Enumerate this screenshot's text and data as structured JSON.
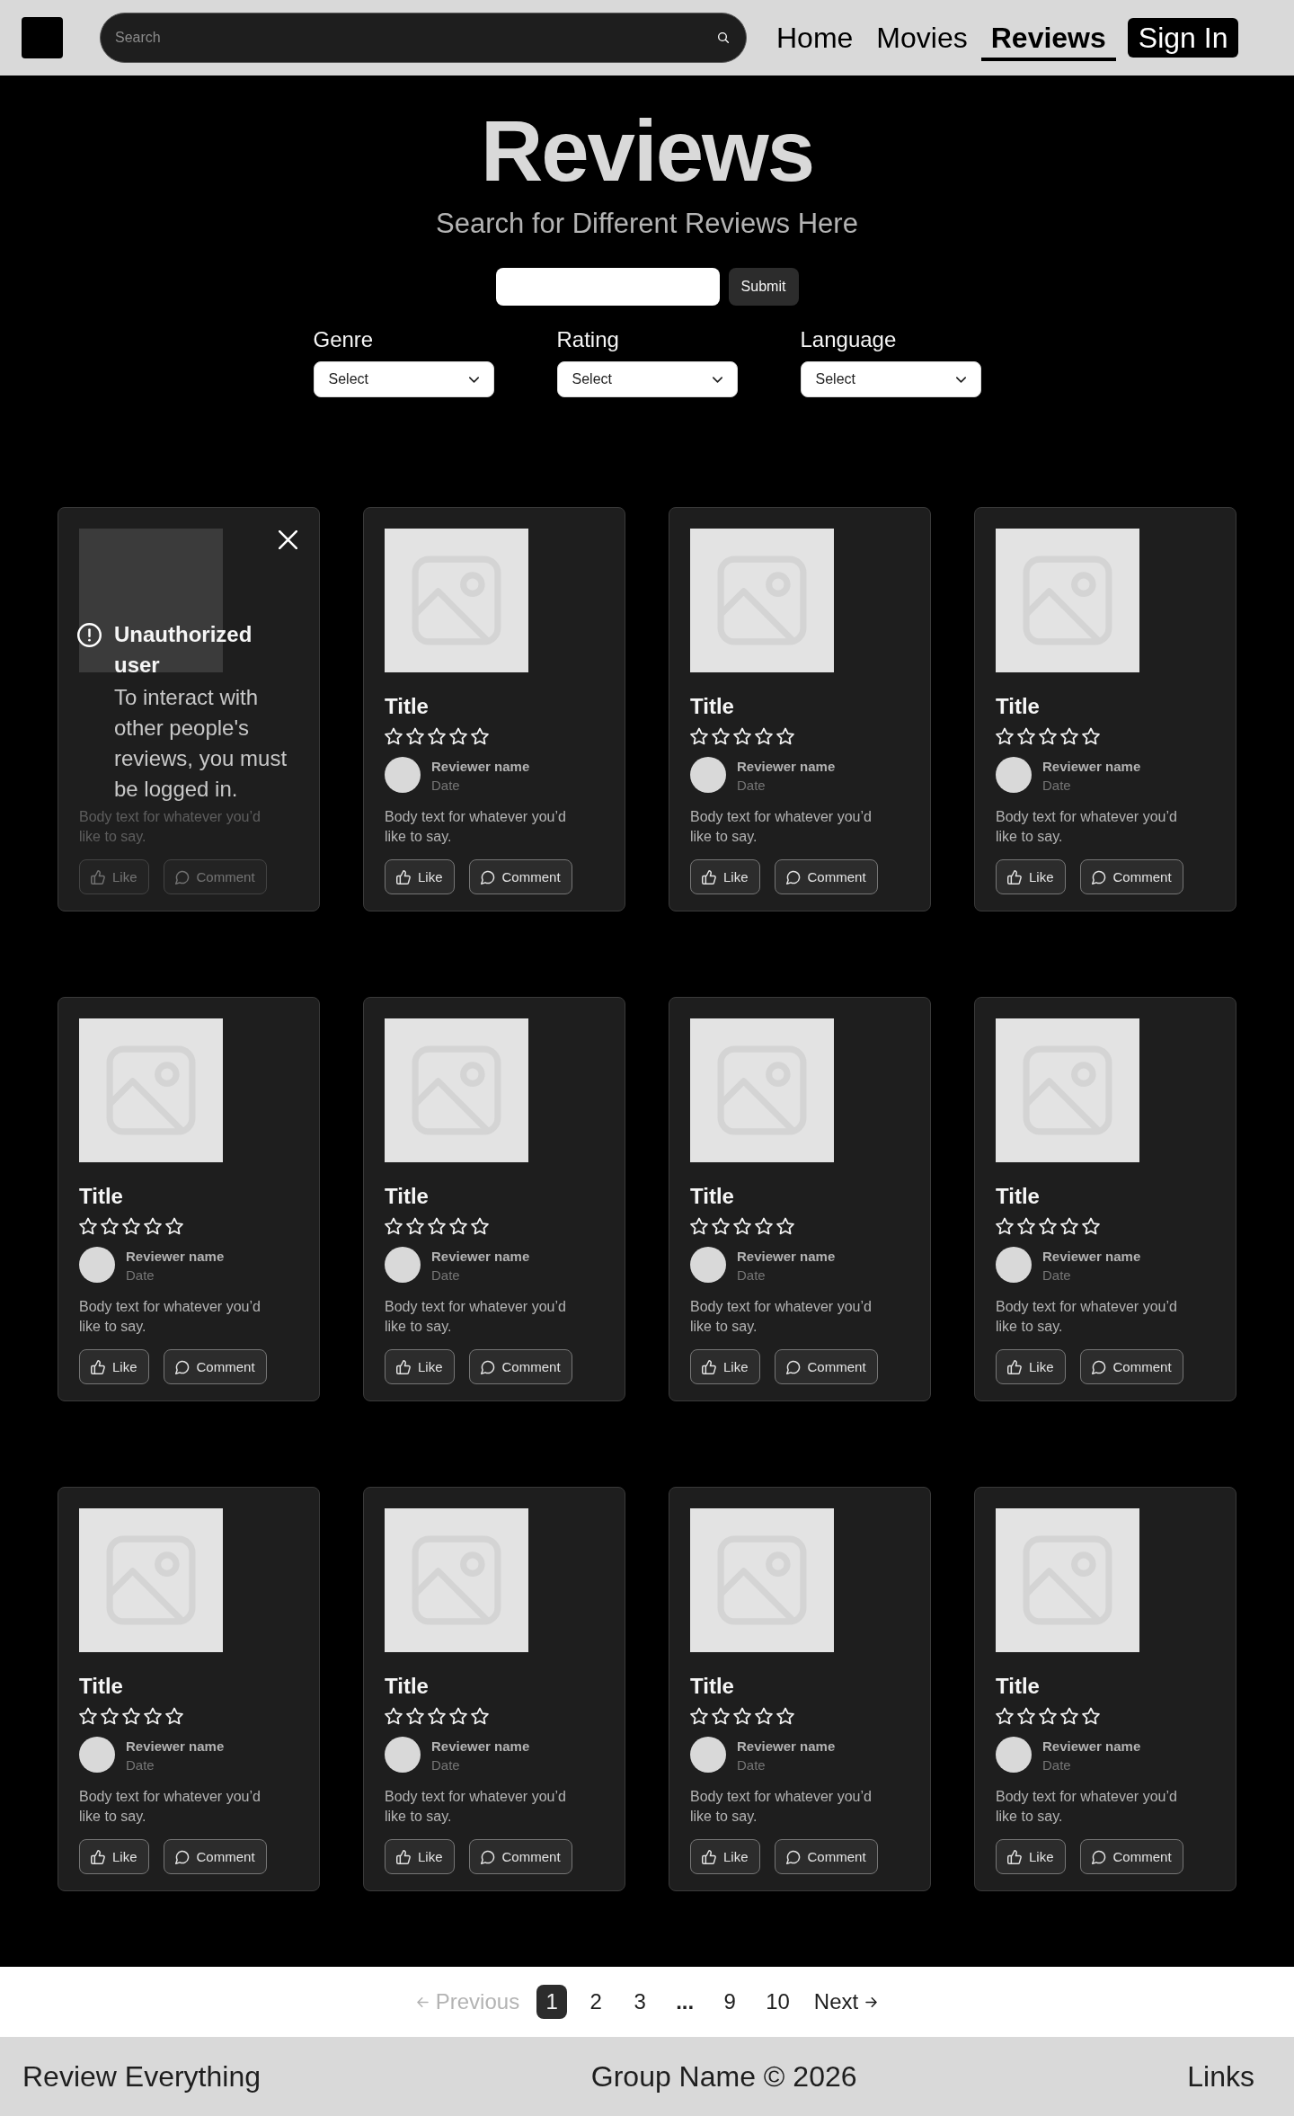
{
  "header": {
    "search": {
      "placeholder": "Search"
    },
    "nav": [
      {
        "label": "Home",
        "selected": false
      },
      {
        "label": "Movies",
        "selected": false
      },
      {
        "label": "Reviews",
        "selected": true
      }
    ],
    "sign_in": "Sign In"
  },
  "hero": {
    "title": "Reviews",
    "subtitle": "Search for Different Reviews Here",
    "submit": "Submit",
    "filters": [
      {
        "label": "Genre",
        "value": "Select"
      },
      {
        "label": "Rating",
        "value": "Select"
      },
      {
        "label": "Language",
        "value": "Select"
      }
    ]
  },
  "reviews": [
    {
      "body": "Body text for whatever you’d like to say.",
      "actions": [
        {
          "kind": "like",
          "label": "Like"
        },
        {
          "kind": "comment",
          "label": "Comment"
        }
      ],
      "locked": true,
      "notice": {
        "title": "Unauthorized user",
        "message": "To interact with other people's reviews, you must be logged in."
      }
    },
    {
      "title": "Title",
      "stars": 0,
      "reviewer": "Reviewer name",
      "date": "Date",
      "body": "Body text for whatever you’d like to say.",
      "actions": [
        {
          "kind": "like",
          "label": "Like"
        },
        {
          "kind": "comment",
          "label": "Comment"
        }
      ],
      "locked": false
    },
    {
      "title": "Title",
      "stars": 0,
      "reviewer": "Reviewer name",
      "date": "Date",
      "body": "Body text for whatever you’d like to say.",
      "actions": [
        {
          "kind": "like",
          "label": "Like"
        },
        {
          "kind": "comment",
          "label": "Comment"
        }
      ],
      "locked": false
    },
    {
      "title": "Title",
      "stars": 0,
      "reviewer": "Reviewer name",
      "date": "Date",
      "body": "Body text for whatever you’d like to say.",
      "actions": [
        {
          "kind": "like",
          "label": "Like"
        },
        {
          "kind": "comment",
          "label": "Comment"
        }
      ],
      "locked": false
    },
    {
      "title": "Title",
      "stars": 0,
      "reviewer": "Reviewer name",
      "date": "Date",
      "body": "Body text for whatever you’d like to say.",
      "actions": [
        {
          "kind": "like",
          "label": "Like"
        },
        {
          "kind": "comment",
          "label": "Comment"
        }
      ],
      "locked": false
    },
    {
      "title": "Title",
      "stars": 0,
      "reviewer": "Reviewer name",
      "date": "Date",
      "body": "Body text for whatever you’d like to say.",
      "actions": [
        {
          "kind": "like",
          "label": "Like"
        },
        {
          "kind": "comment",
          "label": "Comment"
        }
      ],
      "locked": false
    },
    {
      "title": "Title",
      "stars": 0,
      "reviewer": "Reviewer name",
      "date": "Date",
      "body": "Body text for whatever you’d like to say.",
      "actions": [
        {
          "kind": "like",
          "label": "Like"
        },
        {
          "kind": "comment",
          "label": "Comment"
        }
      ],
      "locked": false
    },
    {
      "title": "Title",
      "stars": 0,
      "reviewer": "Reviewer name",
      "date": "Date",
      "body": "Body text for whatever you’d like to say.",
      "actions": [
        {
          "kind": "like",
          "label": "Like"
        },
        {
          "kind": "comment",
          "label": "Comment"
        }
      ],
      "locked": false
    },
    {
      "title": "Title",
      "stars": 0,
      "reviewer": "Reviewer name",
      "date": "Date",
      "body": "Body text for whatever you’d like to say.",
      "actions": [
        {
          "kind": "like",
          "label": "Like"
        },
        {
          "kind": "comment",
          "label": "Comment"
        }
      ],
      "locked": false
    },
    {
      "title": "Title",
      "stars": 0,
      "reviewer": "Reviewer name",
      "date": "Date",
      "body": "Body text for whatever you’d like to say.",
      "actions": [
        {
          "kind": "like",
          "label": "Like"
        },
        {
          "kind": "comment",
          "label": "Comment"
        }
      ],
      "locked": false
    },
    {
      "title": "Title",
      "stars": 0,
      "reviewer": "Reviewer name",
      "date": "Date",
      "body": "Body text for whatever you’d like to say.",
      "actions": [
        {
          "kind": "like",
          "label": "Like"
        },
        {
          "kind": "comment",
          "label": "Comment"
        }
      ],
      "locked": false
    },
    {
      "title": "Title",
      "stars": 0,
      "reviewer": "Reviewer name",
      "date": "Date",
      "body": "Body text for whatever you’d like to say.",
      "actions": [
        {
          "kind": "like",
          "label": "Like"
        },
        {
          "kind": "comment",
          "label": "Comment"
        }
      ],
      "locked": false
    }
  ],
  "pagination": {
    "previous": {
      "label": "Previous",
      "disabled": true
    },
    "pages": [
      {
        "kind": "page",
        "label": "1",
        "selected": true
      },
      {
        "kind": "page",
        "label": "2",
        "selected": false
      },
      {
        "kind": "page",
        "label": "3",
        "selected": false
      },
      {
        "kind": "gap",
        "label": "...",
        "selected": false
      },
      {
        "kind": "page",
        "label": "9",
        "selected": false
      },
      {
        "kind": "page",
        "label": "10",
        "selected": false
      }
    ],
    "next": {
      "label": "Next",
      "disabled": false
    }
  },
  "footer": {
    "brand": "Review Everything",
    "copyright": "Group Name © 2026",
    "links": "Links"
  }
}
